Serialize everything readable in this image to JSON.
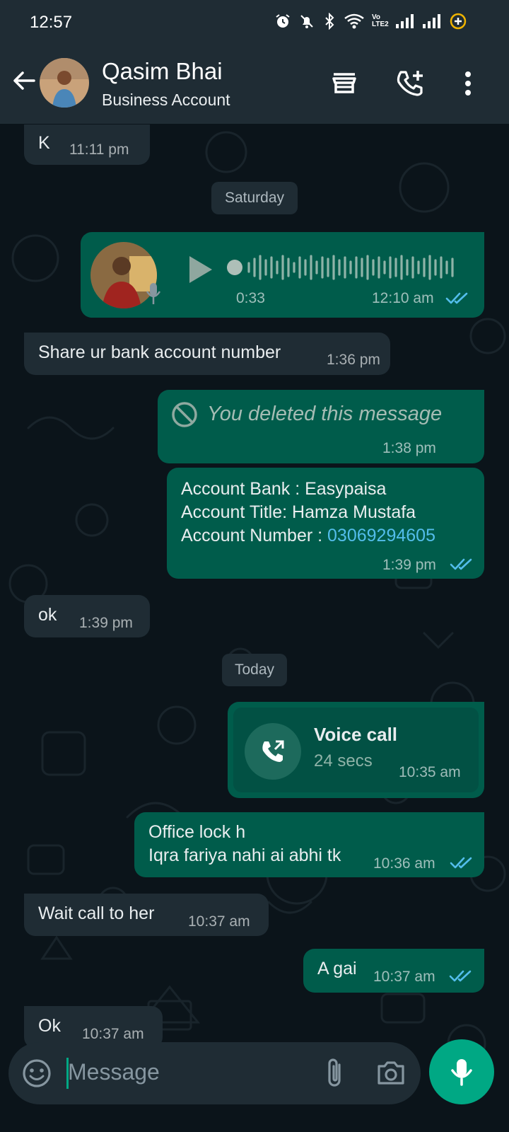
{
  "status_bar": {
    "time": "12:57",
    "network_label": "Vo LTE2"
  },
  "header": {
    "name": "Qasim Bhai",
    "subtitle": "Business Account"
  },
  "messages": [
    {
      "dir": "in",
      "text": "K",
      "time": "11:11 pm"
    },
    {
      "dir": "date",
      "text": "Saturday"
    },
    {
      "dir": "out",
      "type": "voice",
      "duration": "0:33",
      "time": "12:10 am",
      "read": true
    },
    {
      "dir": "in",
      "text": "Share ur bank account number",
      "time": "1:36 pm"
    },
    {
      "dir": "out",
      "type": "deleted",
      "text": "You deleted this message",
      "time": "1:38 pm"
    },
    {
      "dir": "out",
      "lines": [
        "Account Bank : Easypaisa",
        "Account Title: Hamza Mustafa",
        "Account Number : "
      ],
      "link": "03069294605",
      "time": "1:39 pm",
      "read": true
    },
    {
      "dir": "in",
      "text": "ok",
      "time": "1:39 pm"
    },
    {
      "dir": "date",
      "text": "Today"
    },
    {
      "dir": "out",
      "type": "call",
      "title": "Voice call",
      "duration": "24 secs",
      "time": "10:35 am"
    },
    {
      "dir": "out",
      "lines": [
        "Office lock h",
        "Iqra fariya nahi ai abhi tk"
      ],
      "time": "10:36 am",
      "read": true
    },
    {
      "dir": "in",
      "text": "Wait call to her",
      "time": "10:37 am"
    },
    {
      "dir": "out",
      "text": "A gai",
      "time": "10:37 am",
      "read": true
    },
    {
      "dir": "in",
      "text": "Ok",
      "time": "10:37 am"
    }
  ],
  "composer": {
    "placeholder": "Message"
  },
  "colors": {
    "incoming": "#1f2c34",
    "outgoing": "#005c4b",
    "accent": "#00a884",
    "read_ticks": "#53bdeb",
    "background": "#0b141a"
  },
  "icons": [
    "back-arrow-icon",
    "store-icon",
    "add-call-icon",
    "more-vert-icon",
    "emoji-icon",
    "attach-icon",
    "camera-icon",
    "mic-icon",
    "play-icon",
    "deleted-icon",
    "call-icon",
    "read-ticks-icon"
  ]
}
